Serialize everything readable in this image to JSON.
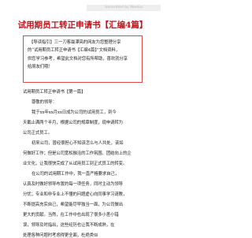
{
  "site_tag": "Generated by WeeGo",
  "title": "试用期员工转正申请书【汇编4篇】",
  "guide_lines": [
    "【导读指引】三一刀客最漂亮的网友为您整理分享",
    "的“试用期员工转正申请书【汇编4篇】”文档资料，",
    "供您学习参考，希望此文档对您有所帮助，喜欢就分享",
    "给朋友们哦！"
  ],
  "body_lines": [
    "试用期员工转正申请书【第一篇】",
    "尊敬的领导：",
    "我于xx年xx月xx日成为公司的试用员工，到今",
    "天截止满两个半月，根据公司的规章制度，现申请转为",
    "公司正式员工。",
    "初来公司，曾经很担心不知该怎么与人共处，该如",
    "何做好工作；但是公司宽松融洽的工作氛围、团结向上的企",
    "业文化，让我很快完成了从试用员工到正式员工的转变。",
    "在公司的试用期工作中，我一直严格要求自己，",
    "认真及时做好领导布置的每一项任务，同时主动为领导",
    "分忧；专业和非专业上不懂的问题虚心向同事学习请教，",
    "不断提高充实自己，希望能尽早独当一面，为公司做出",
    "更大的贡献。当然，在工作中也出现了很多小差小错",
    "误，领导及时指出，这些经历也让我不断成熟，在",
    "处理各种问题时考虑得更全面，杜绝类似"
  ]
}
